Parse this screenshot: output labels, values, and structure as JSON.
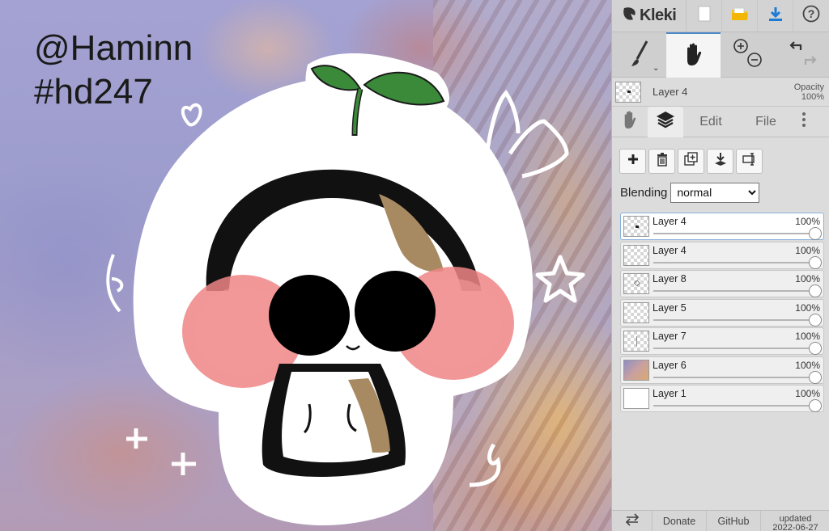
{
  "canvas": {
    "watermark_line1": "@Haminn",
    "watermark_line2": "#hd247"
  },
  "app": {
    "name": "Kleki"
  },
  "topbar": {
    "icons": [
      "kleki-logo-icon",
      "new-file-icon",
      "open-folder-icon",
      "download-icon",
      "help-icon"
    ]
  },
  "tools": {
    "icons": [
      "brush-icon",
      "hand-icon",
      "zoom-icon",
      "undo-redo-icon"
    ],
    "active": "hand"
  },
  "current_layer": {
    "name": "Layer 4",
    "opacity_label": "Opacity",
    "opacity_value": "100%"
  },
  "tabs": {
    "edit": "Edit",
    "file": "File",
    "active": "layers"
  },
  "layer_actions": [
    "add-layer-icon",
    "delete-layer-icon",
    "duplicate-layer-icon",
    "merge-down-icon",
    "rename-layer-icon"
  ],
  "blending": {
    "label": "Blending",
    "value": "normal",
    "options": [
      "normal"
    ]
  },
  "layers": [
    {
      "name": "Layer 4",
      "opacity": "100%",
      "selected": true,
      "thumb": "mark"
    },
    {
      "name": "Layer 4",
      "opacity": "100%",
      "selected": false,
      "thumb": "empty"
    },
    {
      "name": "Layer 8",
      "opacity": "100%",
      "selected": false,
      "thumb": "star"
    },
    {
      "name": "Layer 5",
      "opacity": "100%",
      "selected": false,
      "thumb": "empty"
    },
    {
      "name": "Layer 7",
      "opacity": "100%",
      "selected": false,
      "thumb": "line"
    },
    {
      "name": "Layer 6",
      "opacity": "100%",
      "selected": false,
      "thumb": "photo"
    },
    {
      "name": "Layer 1",
      "opacity": "100%",
      "selected": false,
      "thumb": "white"
    }
  ],
  "bottombar": {
    "donate": "Donate",
    "github": "GitHub",
    "updated_line1": "updated",
    "updated_line2": "2022-06-27"
  },
  "colors": {
    "accent": "#4d88c7",
    "panel": "#dcdcdc",
    "sprout": "#3a8a3a",
    "blush": "#f08585"
  }
}
